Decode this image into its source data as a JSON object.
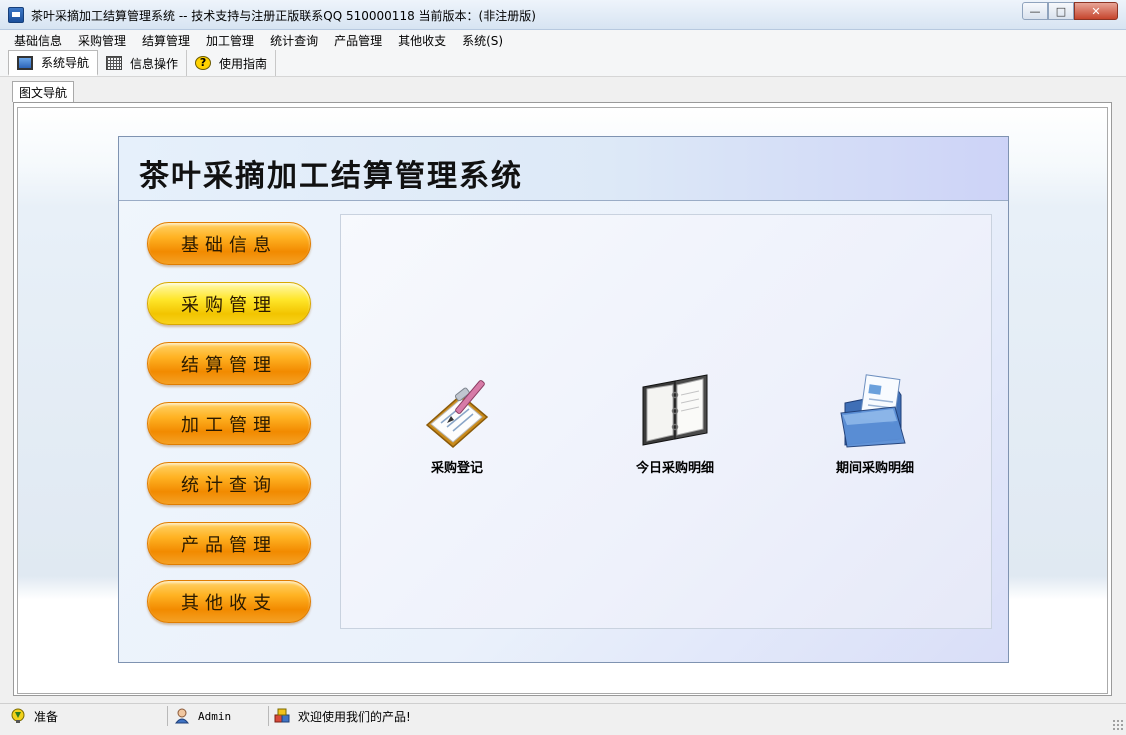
{
  "window": {
    "title": "茶叶采摘加工结算管理系统 -- 技术支持与注册正版联系QQ 510000118    当前版本：(非注册版)"
  },
  "menu": [
    "基础信息",
    "采购管理",
    "结算管理",
    "加工管理",
    "统计查询",
    "产品管理",
    "其他收支",
    "系统(S)"
  ],
  "toolbar": {
    "tabs": [
      {
        "label": "系统导航",
        "icon": "monitor-icon"
      },
      {
        "label": "信息操作",
        "icon": "grid-icon"
      },
      {
        "label": "使用指南",
        "icon": "help-icon"
      }
    ]
  },
  "doc_tab": {
    "label": "图文导航"
  },
  "panel": {
    "title": "茶叶采摘加工结算管理系统",
    "side_buttons": [
      "基础信息",
      "采购管理",
      "结算管理",
      "加工管理",
      "统计查询",
      "产品管理",
      "其他收支"
    ],
    "active_side_button": "采购管理",
    "tiles": [
      {
        "label": "采购登记",
        "icon": "clipboard-pen-icon"
      },
      {
        "label": "今日采购明细",
        "icon": "notebook-icon"
      },
      {
        "label": "期间采购明细",
        "icon": "document-folder-icon"
      }
    ]
  },
  "status": {
    "ready": "准备",
    "user": "Admin",
    "welcome": "欢迎使用我们的产品!"
  }
}
